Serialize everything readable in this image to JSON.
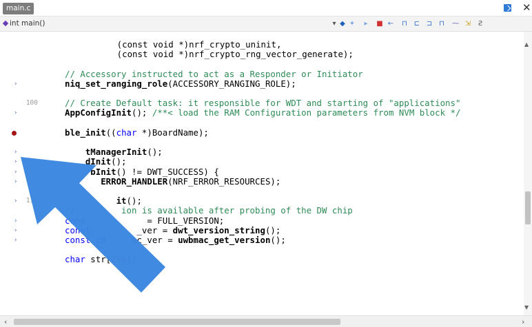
{
  "tab": {
    "title": "main.c"
  },
  "function_nav": {
    "label": "int main()"
  },
  "toolbar": {
    "icons": [
      "dropdown-icon",
      "nav-back-icon",
      "nav-forward-icon",
      "go-icon",
      "stop-icon",
      "step-back-icon",
      "bookmark-icon",
      "bookmark-prev-icon",
      "bookmark-next-icon",
      "bookmark-clear-icon",
      "ellipsis-icon",
      "expand-icon",
      "format-icon"
    ]
  },
  "editor": {
    "lines": [
      {
        "num": "",
        "mark": "",
        "text": [
          {
            "t": "        (",
            "c": ""
          },
          {
            "t": "const void ",
            "c": "kw2"
          },
          {
            "t": "*)nrf_crypto_uninit,",
            "c": ""
          }
        ]
      },
      {
        "num": "",
        "mark": "",
        "text": [
          {
            "t": "        (",
            "c": ""
          },
          {
            "t": "const void ",
            "c": "kw2"
          },
          {
            "t": "*)nrf_crypto_rng_vector_generate);",
            "c": ""
          }
        ]
      },
      {
        "num": "",
        "mark": "",
        "text": []
      },
      {
        "num": "",
        "mark": "",
        "text": [
          {
            "t": "// Accessory instructed to act as a Responder or Initiator",
            "c": "cmt"
          }
        ]
      },
      {
        "num": "",
        "mark": "›",
        "text": [
          {
            "t": "niq_set_ranging_role",
            "c": "fn"
          },
          {
            "t": "(ACCESSORY_RANGING_ROLE);",
            "c": ""
          }
        ]
      },
      {
        "num": "",
        "mark": "",
        "text": []
      },
      {
        "num": "100",
        "mark": "",
        "text": [
          {
            "t": "// Create Default task: it responsible for WDT and starting of \"applications\"",
            "c": "cmt"
          }
        ]
      },
      {
        "num": "",
        "mark": "›",
        "text": [
          {
            "t": "AppConfigInit",
            "c": "fn"
          },
          {
            "t": "(); ",
            "c": ""
          },
          {
            "t": "/**< load the RAM Configuration parameters from NVM block */",
            "c": "cmt"
          }
        ]
      },
      {
        "num": "",
        "mark": "",
        "text": []
      },
      {
        "num": "",
        "mark": "bp",
        "text": [
          {
            "t": "ble_init",
            "c": "fn"
          },
          {
            "t": "((",
            "c": ""
          },
          {
            "t": "char",
            "c": "kw"
          },
          {
            "t": " *)BoardName);",
            "c": ""
          }
        ]
      },
      {
        "num": "",
        "mark": "",
        "text": []
      },
      {
        "num": "",
        "mark": "›",
        "text": [
          {
            "t": "    tManagerInit",
            "c": "fn"
          },
          {
            "t": "();",
            "c": ""
          }
        ]
      },
      {
        "num": "",
        "mark": "›",
        "text": [
          {
            "t": "    dInit",
            "c": "fn"
          },
          {
            "t": "();",
            "c": ""
          }
        ]
      },
      {
        "num": "",
        "mark": "›",
        "text": [
          {
            "t": "     bInit",
            "c": "fn"
          },
          {
            "t": "() != DWT_SUCCESS) {",
            "c": ""
          }
        ]
      },
      {
        "num": "",
        "mark": "›",
        "text": [
          {
            "t": "       ERROR_HANDLER",
            "c": "fn"
          },
          {
            "t": "(NRF_ERROR_RESOURCES);",
            "c": ""
          }
        ]
      },
      {
        "num": "",
        "mark": "",
        "text": []
      },
      {
        "num": "110",
        "mark": "›",
        "text": [
          {
            "t": "          it",
            "c": "fn"
          },
          {
            "t": "();",
            "c": ""
          }
        ]
      },
      {
        "num": "",
        "mark": "",
        "text": [
          {
            "t": "//         ion is available after probing of the DW chip",
            "c": "cmt"
          }
        ]
      },
      {
        "num": "",
        "mark": "›",
        "text": [
          {
            "t": "cons",
            "c": "kw"
          },
          {
            "t": "            = FULL_VERSION;",
            "c": ""
          }
        ]
      },
      {
        "num": "",
        "mark": "›",
        "text": [
          {
            "t": "const",
            "c": "kw"
          },
          {
            "t": "         _ver = ",
            "c": ""
          },
          {
            "t": "dwt_version_string",
            "c": "fn"
          },
          {
            "t": "();",
            "c": ""
          }
        ]
      },
      {
        "num": "",
        "mark": "›",
        "text": [
          {
            "t": "const ch",
            "c": "kw"
          },
          {
            "t": "     ac_ver = ",
            "c": ""
          },
          {
            "t": "uwbmac_get_version",
            "c": "fn"
          },
          {
            "t": "();",
            "c": ""
          }
        ]
      },
      {
        "num": "",
        "mark": "",
        "text": []
      },
      {
        "num": "",
        "mark": "",
        "text": [
          {
            "t": "char",
            "c": "kw"
          },
          {
            "t": " str[",
            "c": ""
          },
          {
            "t": "256",
            "c": "num"
          },
          {
            "t": "];",
            "c": ""
          }
        ]
      }
    ]
  },
  "colors": {
    "arrow": "#3a86e0",
    "comment": "#2e8b57",
    "keyword": "#0000ff",
    "number": "#c8102e",
    "breakpoint": "#a31515"
  }
}
